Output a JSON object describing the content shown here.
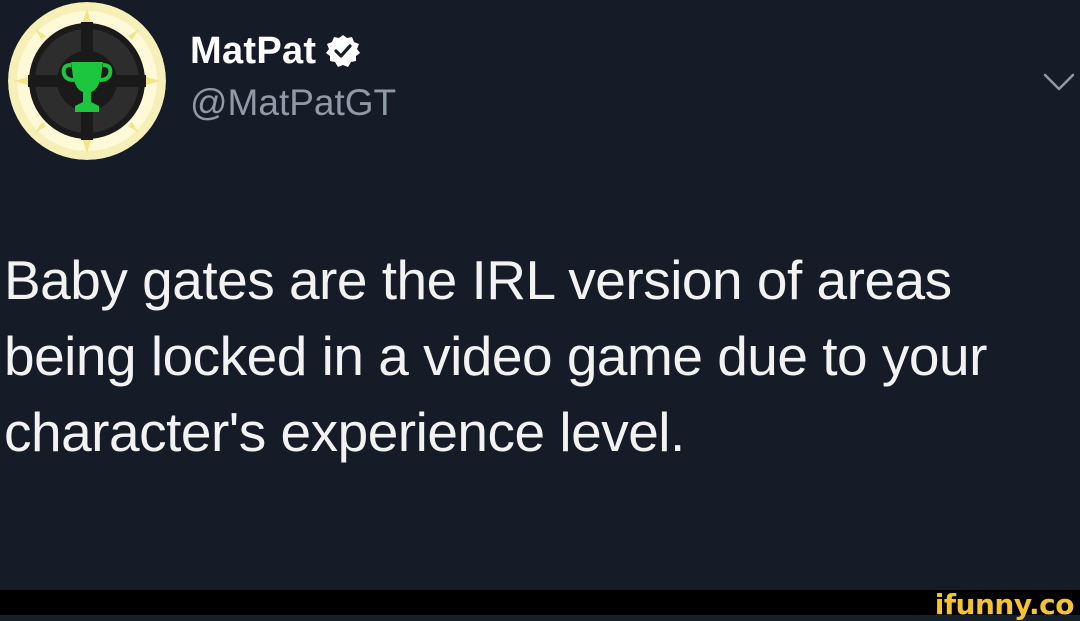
{
  "tweet": {
    "author": {
      "display_name": "MatPat",
      "handle": "@MatPatGT",
      "verified": true
    },
    "text": "Baby gates are the IRL version of areas being locked in a video game due to your character's experience level."
  },
  "icons": {
    "avatar": "game-theory-logo",
    "verified": "verified-badge-icon",
    "menu": "chevron-down-icon"
  },
  "colors": {
    "background": "#151c27",
    "handle": "#8e9aa6",
    "verified_badge": "#ffffff",
    "avatar_ring": "#f6f0b8",
    "trophy": "#1cc63e",
    "watermark": "#f4c430"
  },
  "watermark": "ifunny.co"
}
